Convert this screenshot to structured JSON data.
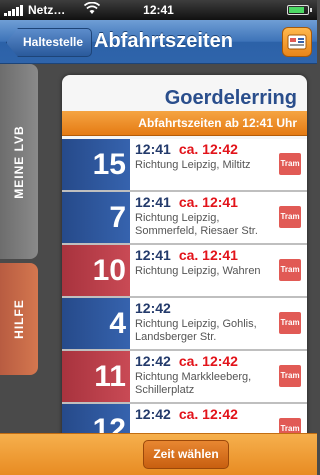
{
  "status_bar": {
    "carrier": "Netz…",
    "time": "12:41",
    "battery_level": 0.85
  },
  "nav": {
    "back_label": "Haltestelle",
    "title": "Abfahrtszeiten",
    "icon": "timetable-icon"
  },
  "side_tabs": {
    "meine_lvb": "MEINE LVB",
    "hilfe": "HILFE"
  },
  "stop_name": "Goerdelerring",
  "banner": "Abfahrtszeiten ab 12:41 Uhr",
  "departures": [
    {
      "line": "15",
      "color": "blue",
      "time": "12:41",
      "eta": "ca. 12:42",
      "direction": "Richtung Leipzig, Miltitz",
      "type": "Tram"
    },
    {
      "line": "7",
      "color": "blue",
      "time": "12:41",
      "eta": "ca. 12:41",
      "direction": "Richtung Leipzig, Sommerfeld, Riesaer Str.",
      "type": "Tram"
    },
    {
      "line": "10",
      "color": "red",
      "time": "12:41",
      "eta": "ca. 12:41",
      "direction": "Richtung Leipzig, Wahren",
      "type": "Tram"
    },
    {
      "line": "4",
      "color": "blue",
      "time": "12:42",
      "eta": "",
      "direction": "Richtung Leipzig, Gohlis, Landsberger Str.",
      "type": "Tram"
    },
    {
      "line": "11",
      "color": "red",
      "time": "12:42",
      "eta": "ca. 12:42",
      "direction": "Richtung Markkleeberg, Schillerplatz",
      "type": "Tram"
    },
    {
      "line": "12",
      "color": "blue",
      "time": "12:42",
      "eta": "ca. 12:42",
      "direction": "",
      "type": "Tram"
    }
  ],
  "bottom": {
    "zeit_button": "Zeit wählen"
  }
}
